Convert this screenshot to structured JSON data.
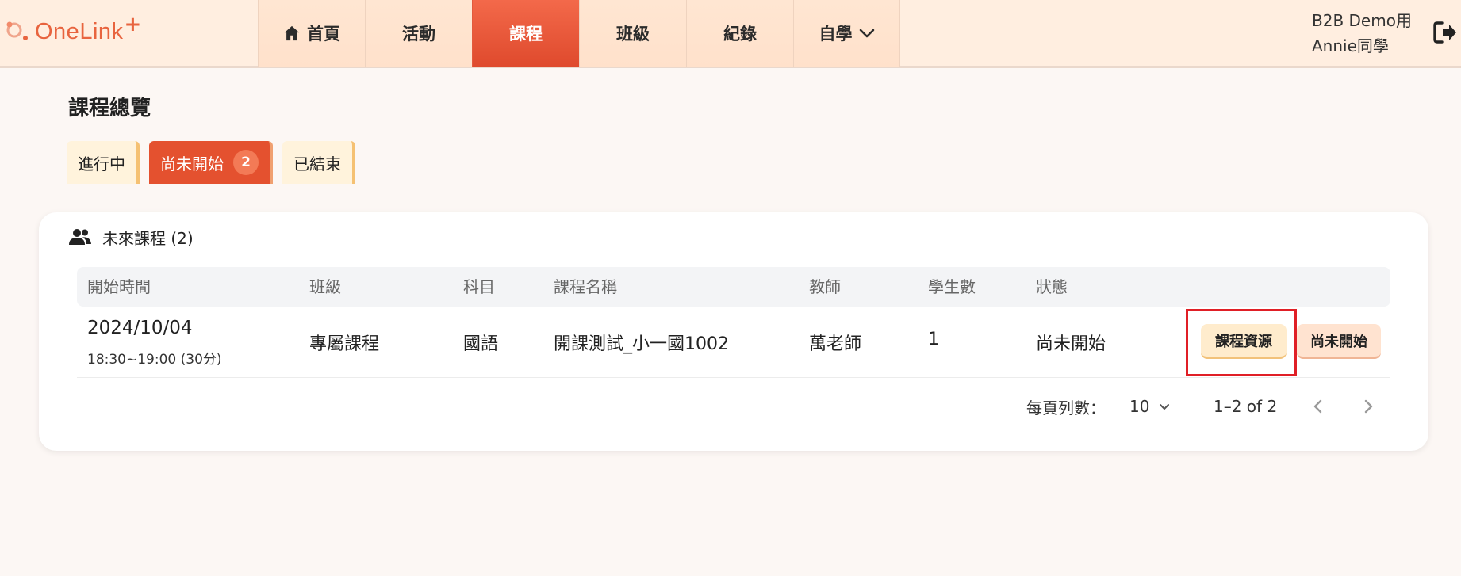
{
  "header": {
    "logo_text": "OneLink",
    "logo_plus": "+",
    "nav": [
      {
        "label": "首頁",
        "icon": "home-icon"
      },
      {
        "label": "活動"
      },
      {
        "label": "課程",
        "active": true
      },
      {
        "label": "班級"
      },
      {
        "label": "紀錄"
      },
      {
        "label": "自學",
        "icon": "chevron-down-icon"
      }
    ],
    "user_org": "B2B Demo用",
    "user_name": "Annie同學",
    "logout_icon": "logout-icon"
  },
  "page_title": "課程總覽",
  "tabs": [
    {
      "label": "進行中"
    },
    {
      "label": "尚未開始",
      "badge": "2",
      "active": true
    },
    {
      "label": "已結束"
    }
  ],
  "card": {
    "title": "未來課程 (2)",
    "icon": "people-icon",
    "columns": [
      "開始時間",
      "班級",
      "科目",
      "課程名稱",
      "教師",
      "學生數",
      "狀態"
    ],
    "rows": [
      {
        "date": "2024/10/04",
        "time": "18:30~19:00 (30分)",
        "class": "專屬課程",
        "subject": "國語",
        "course_name": "開課測試_小一國1002",
        "teacher": "萬老師",
        "students": "1",
        "status": "尚未開始",
        "resource_button": "課程資源",
        "status_button": "尚未開始"
      }
    ],
    "pagination": {
      "rows_per_page_label": "每頁列數：",
      "rows_per_page": "10",
      "range": "1–2 of 2"
    }
  },
  "colors": {
    "accent": "#e4512f",
    "header_bg": "#ffeee0",
    "highlight": "#e01f26"
  }
}
